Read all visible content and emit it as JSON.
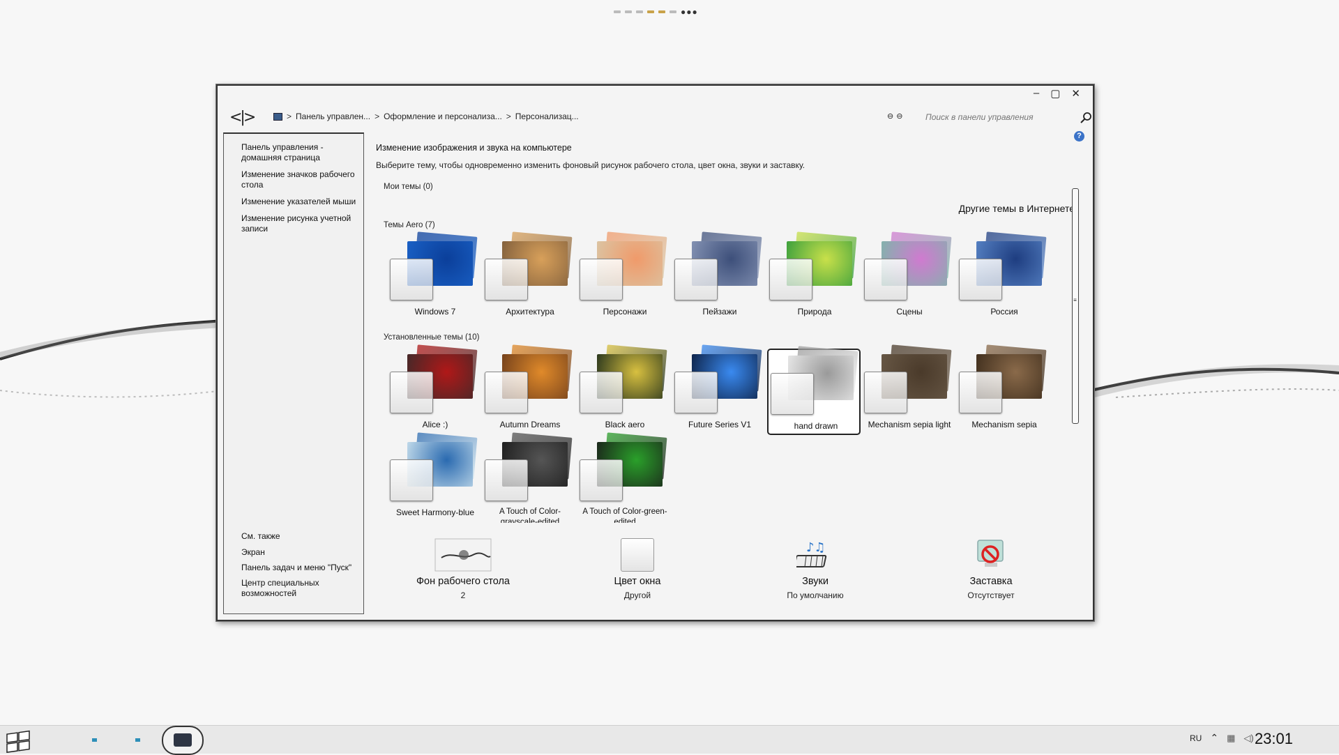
{
  "window": {
    "breadcrumb": [
      "Панель управлен...",
      "Оформление и персонализа...",
      "Персонализац..."
    ],
    "search_placeholder": "Поиск в панели управления",
    "controls": {
      "minimize": "–",
      "maximize": "▢",
      "close": "✕"
    },
    "nav": {
      "back_forward": "<|>"
    }
  },
  "sidebar": {
    "links": [
      "Панель управления - домашняя страница",
      "Изменение значков рабочего стола",
      "Изменение указателей мыши",
      "Изменение рисунка учетной записи"
    ],
    "see_also_title": "См. также",
    "see_also": [
      "Экран",
      "Панель задач и меню \"Пуск\"",
      "Центр специальных возможностей"
    ]
  },
  "main": {
    "title": "Изменение изображения и звука на компьютере",
    "description": "Выберите тему, чтобы одновременно изменить фоновый рисунок рабочего стола, цвет окна, звуки и заставку.",
    "my_themes": "Мои темы (0)",
    "online_link": "Другие темы в Интернете",
    "aero_group": "Темы Aero (7)",
    "aero_themes": [
      {
        "name": "Windows 7",
        "bg": "#1b63c9",
        "bg2": "#0b3f9a"
      },
      {
        "name": "Архитектура",
        "bg": "#7a5a3a",
        "bg2": "#d8a05a"
      },
      {
        "name": "Персонажи",
        "bg": "#d9c8a8",
        "bg2": "#f09a6a"
      },
      {
        "name": "Пейзажи",
        "bg": "#8a98b8",
        "bg2": "#3d4f7a"
      },
      {
        "name": "Природа",
        "bg": "#2f9a3c",
        "bg2": "#c9e04a"
      },
      {
        "name": "Сцены",
        "bg": "#7ab8a8",
        "bg2": "#d07ad0"
      },
      {
        "name": "Россия",
        "bg": "#5a86c8",
        "bg2": "#1e3d80"
      }
    ],
    "installed_group": "Установленные темы (10)",
    "installed_themes": [
      {
        "name": "Alice :)",
        "bg": "#3a2a2a",
        "bg2": "#b01818"
      },
      {
        "name": "Autumn Dreams",
        "bg": "#6a3a1a",
        "bg2": "#e08a2a"
      },
      {
        "name": "Black aero",
        "bg": "#1a2a1a",
        "bg2": "#d8c040"
      },
      {
        "name": "Future Series V1",
        "bg": "#0a1a3a",
        "bg2": "#3a8af0"
      },
      {
        "name": "hand drawn",
        "bg": "#eeeeee",
        "bg2": "#9a9a9a"
      },
      {
        "name": "Mechanism sepia light",
        "bg": "#6a5a48",
        "bg2": "#4a3a2a"
      },
      {
        "name": "Mechanism sepia",
        "bg": "#3a2a1a",
        "bg2": "#8a6a4a"
      },
      {
        "name": "Sweet Harmony-blue",
        "bg": "#cfe4ef",
        "bg2": "#2a6ab0"
      },
      {
        "name": "A Touch of Color-grayscale-edited",
        "bg": "#1a1a1a",
        "bg2": "#555555"
      },
      {
        "name": "A Touch of Color-green-edited",
        "bg": "#1a1a1a",
        "bg2": "#2aa02a"
      }
    ]
  },
  "bottom": {
    "wallpaper": {
      "label": "Фон рабочего стола",
      "value": "2"
    },
    "color": {
      "label": "Цвет окна",
      "value": "Другой"
    },
    "sounds": {
      "label": "Звуки",
      "value": "По умолчанию"
    },
    "screensaver": {
      "label": "Заставка",
      "value": "Отсутствует"
    }
  },
  "taskbar": {
    "language": "RU",
    "clock": "23:01"
  }
}
